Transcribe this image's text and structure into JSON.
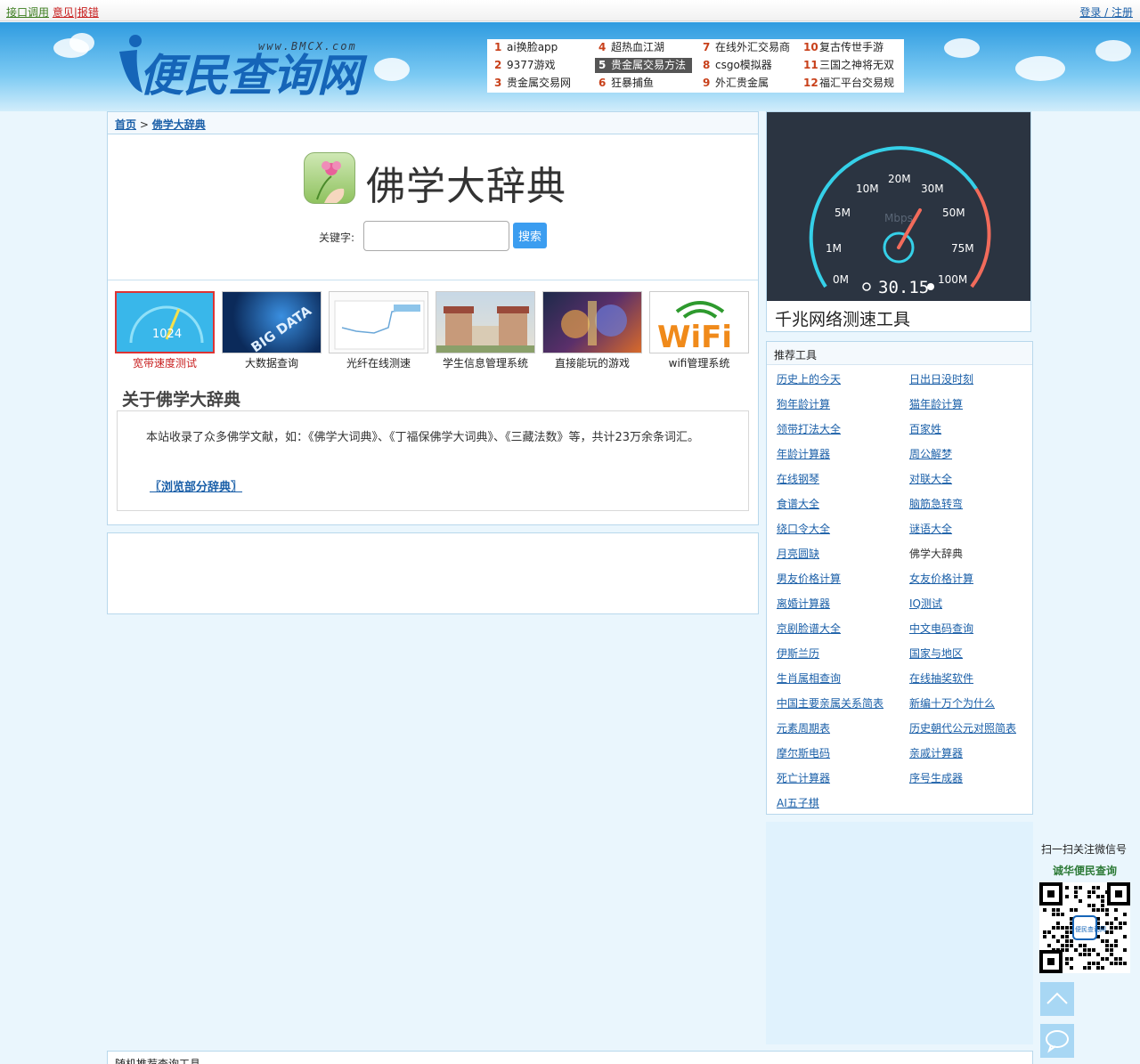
{
  "topbar": {
    "api_link": "接口调用",
    "feedback_link": "意见|报错",
    "login_link": "登录 / 注册"
  },
  "logo": {
    "url_text": "www.BMCX.com",
    "name": "便民查询网"
  },
  "hot_list": [
    {
      "n": "1",
      "t": "ai换脸app"
    },
    {
      "n": "2",
      "t": "9377游戏"
    },
    {
      "n": "3",
      "t": "贵金属交易网"
    },
    {
      "n": "4",
      "t": "超热血江湖"
    },
    {
      "n": "5",
      "t": "贵金属交易方法"
    },
    {
      "n": "6",
      "t": "狂暴捕鱼"
    },
    {
      "n": "7",
      "t": "在线外汇交易商"
    },
    {
      "n": "8",
      "t": "csgo模拟器"
    },
    {
      "n": "9",
      "t": "外汇贵金属"
    },
    {
      "n": "10",
      "t": "复古传世手游"
    },
    {
      "n": "11",
      "t": "三国之神将无双"
    },
    {
      "n": "12",
      "t": "福汇平台交易规"
    }
  ],
  "breadcrumb": {
    "home": "首页",
    "sep": ">",
    "current": "佛学大辞典"
  },
  "main": {
    "title": "佛学大辞典",
    "search_label": "关键字:",
    "search_value": "",
    "search_button": "搜索"
  },
  "thumbs": [
    {
      "label": "宽带速度测试",
      "img_text": "1024"
    },
    {
      "label": "大数据查询",
      "img_text": "BIG DATA"
    },
    {
      "label": "光纤在线测速",
      "img_text": ""
    },
    {
      "label": "学生信息管理系统",
      "img_text": ""
    },
    {
      "label": "直接能玩的游戏",
      "img_text": ""
    },
    {
      "label": "wifi管理系统",
      "img_text": "WiFi"
    }
  ],
  "about": {
    "heading": "关于佛学大辞典",
    "text": "本站收录了众多佛学文献，如：《佛学大词典》、《丁福保佛学大词典》、《三藏法数》等，共计23万余条词汇。",
    "browse_link": "〖浏览部分辞典〗"
  },
  "speedtest": {
    "caption": "千兆网络测速工具",
    "unit": "Mbps",
    "reading": "30.15",
    "ticks": [
      "0M",
      "1M",
      "5M",
      "10M",
      "20M",
      "30M",
      "50M",
      "75M",
      "100M"
    ]
  },
  "recommend": {
    "heading": "推荐工具",
    "items": [
      "历史上的今天",
      "日出日没时刻",
      "狗年龄计算",
      "猫年龄计算",
      "领带打法大全",
      "百家姓",
      "年龄计算器",
      "周公解梦",
      "在线钢琴",
      "对联大全",
      "食谱大全",
      "脑筋急转弯",
      "绕口令大全",
      "谜语大全",
      "月亮圆缺",
      "佛学大辞典",
      "男友价格计算",
      "女友价格计算",
      "离婚计算器",
      "IQ测试",
      "京剧脸谱大全",
      "中文电码查询",
      "伊斯兰历",
      "国家与地区",
      "生肖属相查询",
      "在线抽奖软件",
      "中国主要亲属关系简表",
      "新编十万个为什么",
      "元素周期表",
      "历史朝代公元对照简表",
      "摩尔斯电码",
      "亲戚计算器",
      "死亡计算器",
      "序号生成器",
      "AI五子棋"
    ]
  },
  "qr": {
    "line1": "扫一扫关注微信号",
    "line2": "诚华便民查询",
    "logo_text": "便民查询网"
  },
  "bottom": {
    "heading": "随机推荐查询工具"
  },
  "colors": {
    "link": "#1a5fa8",
    "accent_red": "#c81f1f",
    "panel_border": "#b8d8ec",
    "search_button": "#3b9df0",
    "gauge_cyan": "#35d0e8",
    "gauge_red": "#f26b5b"
  }
}
